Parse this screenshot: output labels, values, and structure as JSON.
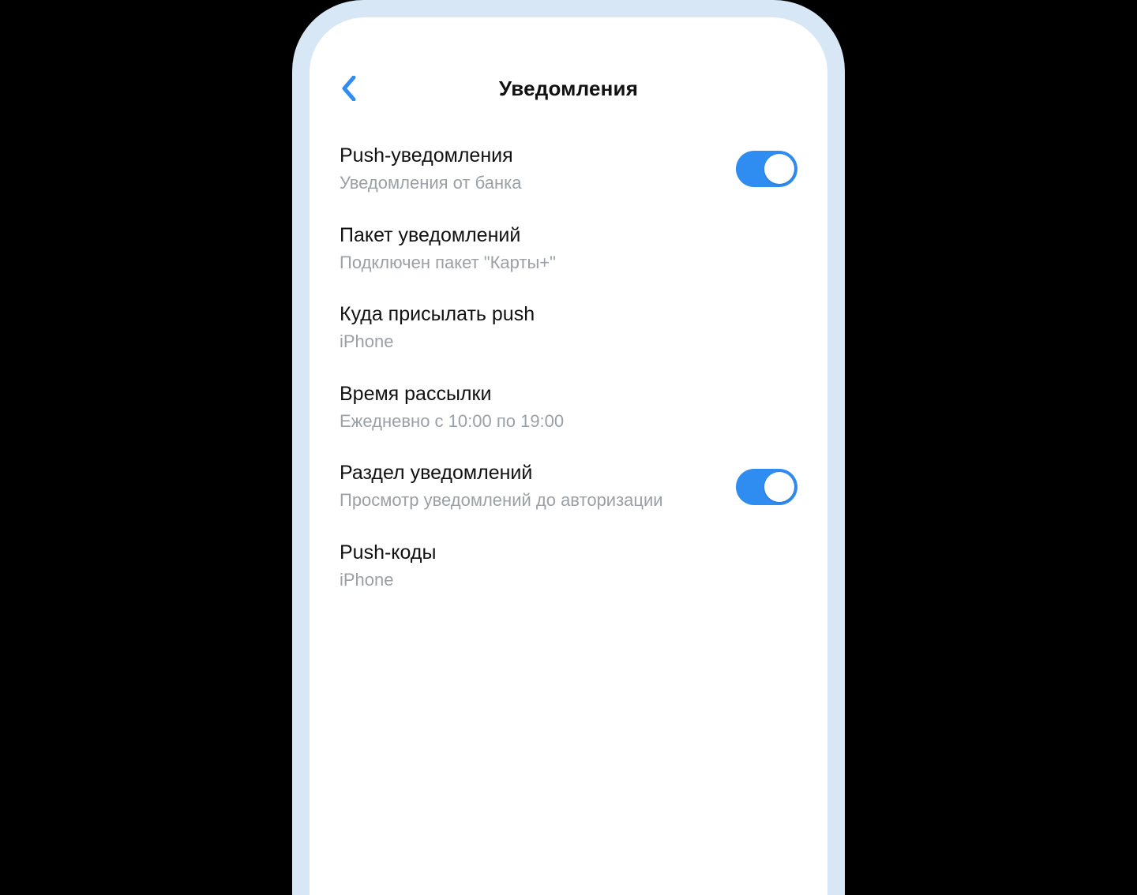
{
  "colors": {
    "accent": "#2f8cf0",
    "frame": "#d7e7f5",
    "text_primary": "#111111",
    "text_secondary": "#9aa0a6"
  },
  "nav": {
    "title": "Уведомления"
  },
  "rows": [
    {
      "title": "Push-уведомления",
      "subtitle": "Уведомления от банка",
      "toggle": true,
      "toggle_on": true
    },
    {
      "title": "Пакет уведомлений",
      "subtitle": "Подключен пакет \"Карты+\"",
      "toggle": false
    },
    {
      "title": "Куда присылать push",
      "subtitle": "iPhone",
      "toggle": false
    },
    {
      "title": "Время рассылки",
      "subtitle": "Ежедневно с 10:00 по 19:00",
      "toggle": false
    },
    {
      "title": "Раздел уведомлений",
      "subtitle": "Просмотр уведомлений до авторизации",
      "toggle": true,
      "toggle_on": true
    },
    {
      "title": "Push-коды",
      "subtitle": "iPhone",
      "toggle": false
    }
  ]
}
